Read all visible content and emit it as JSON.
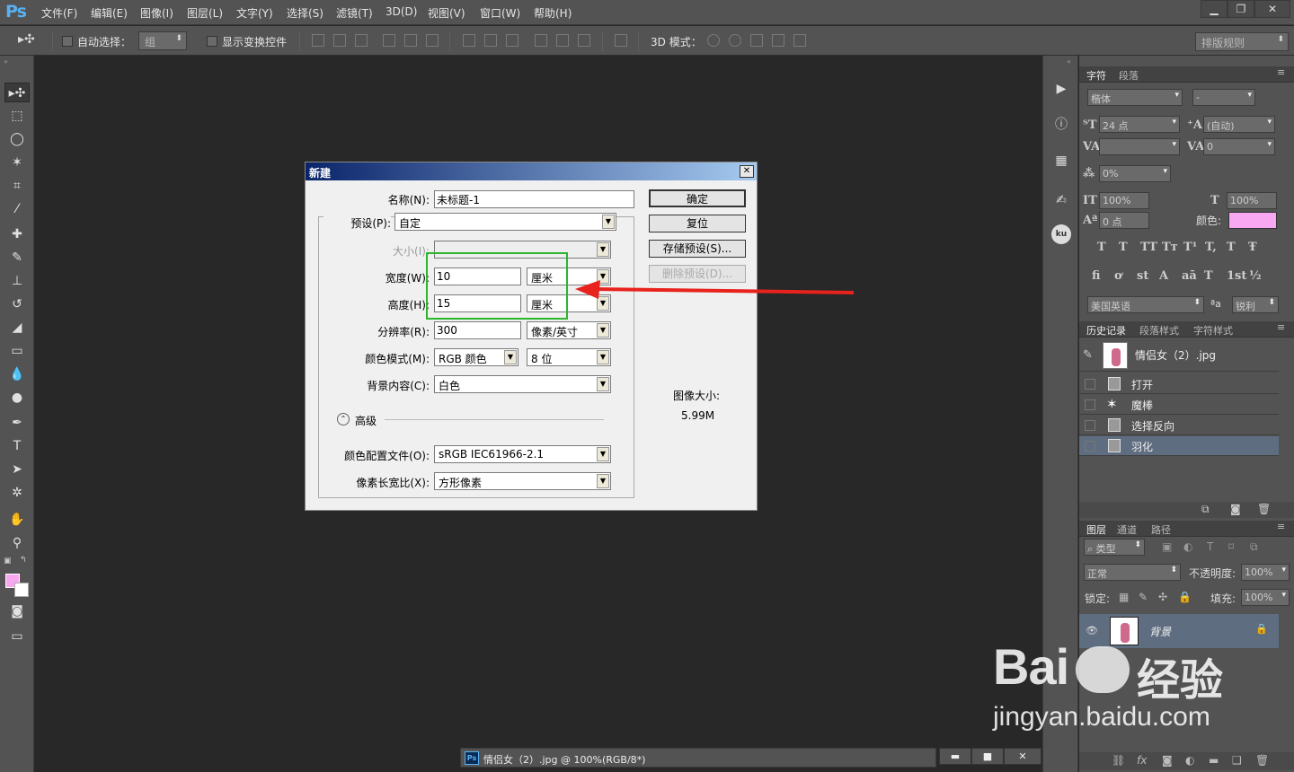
{
  "app": {
    "logo": "Ps"
  },
  "menu": {
    "items": [
      "文件(F)",
      "编辑(E)",
      "图像(I)",
      "图层(L)",
      "文字(Y)",
      "选择(S)",
      "滤镜(T)",
      "3D(D)",
      "视图(V)",
      "窗口(W)",
      "帮助(H)"
    ],
    "window_buttons": [
      "▁",
      "❐",
      "✕"
    ]
  },
  "options_bar": {
    "auto_select_label": "自动选择：",
    "auto_select_value": "组",
    "show_transform_label": "显示变换控件",
    "mode_3d_label": "3D 模式：",
    "arrange_rule": "排版规则"
  },
  "tools": [
    "move-tool",
    "marquee-tool",
    "lasso-tool",
    "magic-wand-tool",
    "crop-tool",
    "eyedropper-tool",
    "healing-tool",
    "brush-tool",
    "stamp-tool",
    "history-brush-tool",
    "eraser-tool",
    "gradient-tool",
    "blur-tool",
    "dodge-tool",
    "pen-tool",
    "type-tool",
    "path-select-tool",
    "shape-tool",
    "hand-tool",
    "zoom-tool"
  ],
  "colors": {
    "foreground": "#f7a8f0",
    "background": "#ffffff",
    "arrow": "#e8221c",
    "highlight": "#2db52d"
  },
  "dialog": {
    "title": "新建",
    "name_label": "名称(N):",
    "name_value": "未标题-1",
    "preset_label": "预设(P):",
    "preset_value": "自定",
    "size_label": "大小(I):",
    "width_label": "宽度(W):",
    "width_value": "10",
    "width_unit": "厘米",
    "height_label": "高度(H):",
    "height_value": "15",
    "height_unit": "厘米",
    "resolution_label": "分辨率(R):",
    "resolution_value": "300",
    "resolution_unit": "像素/英寸",
    "color_mode_label": "颜色模式(M):",
    "color_mode_value": "RGB 颜色",
    "bit_depth_value": "8 位",
    "bg_content_label": "背景内容(C):",
    "bg_content_value": "白色",
    "advanced_label": "高级",
    "color_profile_label": "颜色配置文件(O):",
    "color_profile_value": "sRGB IEC61966-2.1",
    "pixel_aspect_label": "像素长宽比(X):",
    "pixel_aspect_value": "方形像素",
    "ok_button": "确定",
    "reset_button": "复位",
    "save_preset_button": "存储预设(S)...",
    "delete_preset_button": "删除预设(D)...",
    "image_size_label": "图像大小:",
    "image_size_value": "5.99M"
  },
  "character_panel": {
    "tabs": [
      "字符",
      "段落"
    ],
    "font_family": "楷体",
    "font_style": "-",
    "font_size": "24 点",
    "leading": "(自动)",
    "kerning": "",
    "tracking": "0",
    "tsume": "0%",
    "vertical_scale": "100%",
    "horizontal_scale": "100%",
    "baseline_shift": "0 点",
    "color_label": "颜色:",
    "color": "#f7a8f0",
    "style_glyphs": [
      "T",
      "T",
      "TT",
      "Tт",
      "T¹",
      "T,",
      "T",
      "Ŧ"
    ],
    "opentype_glyphs": [
      "fi",
      "ơ",
      "st",
      "A",
      "aā",
      "T",
      "1st",
      "½"
    ],
    "language": "美国英语",
    "aa_label": "ªa",
    "antialias": "锐利"
  },
  "history_panel": {
    "tabs": [
      "历史记录",
      "段落样式",
      "字符样式"
    ],
    "snapshot": "情侣女（2）.jpg",
    "steps": [
      "打开",
      "魔棒",
      "选择反向",
      "羽化"
    ]
  },
  "layers_panel": {
    "tabs": [
      "图层",
      "通道",
      "路径"
    ],
    "filter": "类型",
    "blend_mode": "正常",
    "opacity_label": "不透明度:",
    "opacity": "100%",
    "lock_label": "锁定:",
    "fill_label": "填充:",
    "fill": "100%",
    "layer_name": "背景"
  },
  "document_tab": {
    "title": "情侣女（2）.jpg @ 100%(RGB/8*)",
    "controls": [
      "▬",
      "■",
      "✕"
    ]
  },
  "watermark": {
    "brand": "Bai",
    "brand2": "经验",
    "url": "jingyan.baidu.com"
  }
}
